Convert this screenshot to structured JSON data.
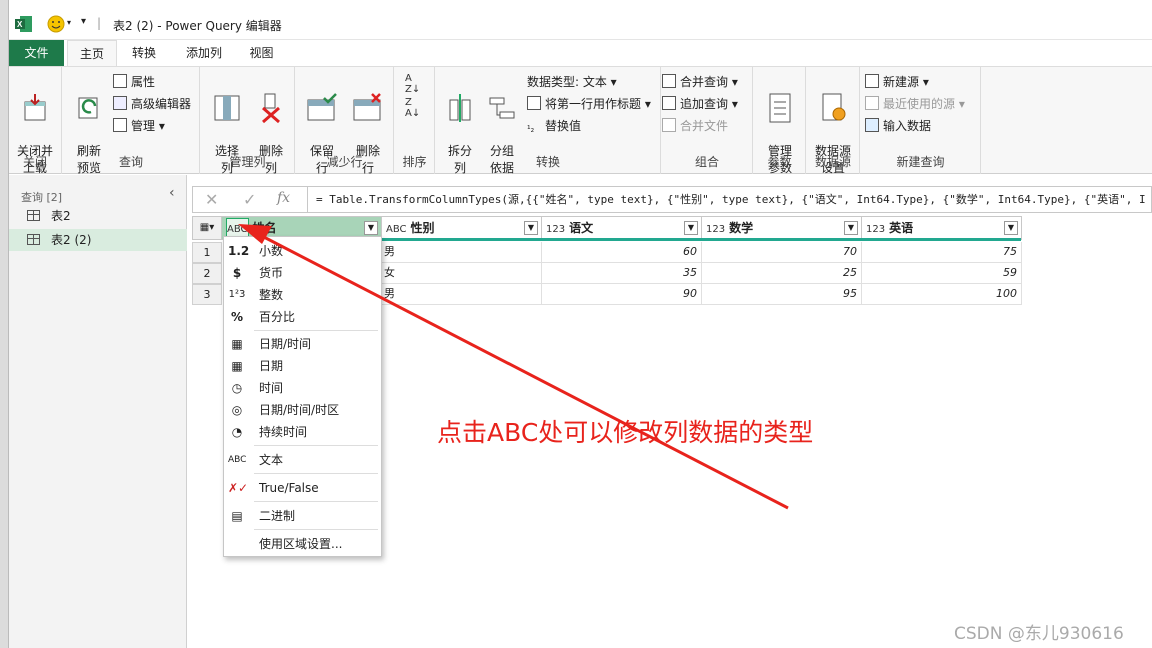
{
  "window": {
    "title": "表2 (2) - Power Query 编辑器"
  },
  "ribbon_tabs": [
    "文件",
    "主页",
    "转换",
    "添加列",
    "视图"
  ],
  "groups": {
    "close": {
      "label": "关闭",
      "btn": "关闭并\n上载"
    },
    "query": {
      "label": "查询",
      "refresh": "刷新\n预览",
      "props": "属性",
      "adv": "高级编辑器",
      "manage": "管理"
    },
    "cols": {
      "label": "管理列",
      "choose": "选择\n列",
      "remove": "删除\n列"
    },
    "rows": {
      "label": "减少行",
      "keep": "保留\n行",
      "remove": "删除\n行"
    },
    "sort": {
      "label": "排序"
    },
    "transform": {
      "label": "转换",
      "split": "拆分\n列",
      "group": "分组\n依据",
      "dtype": "数据类型: 文本",
      "firstrow": "将第一行用作标题",
      "replace": "替换值"
    },
    "combine": {
      "label": "组合",
      "merge": "合并查询",
      "append": "追加查询",
      "files": "合并文件"
    },
    "params": {
      "label": "参数",
      "manage": "管理\n参数"
    },
    "ds": {
      "label": "数据源",
      "settings": "数据源\n设置"
    },
    "newq": {
      "label": "新建查询",
      "new": "新建源",
      "recent": "最近使用的源",
      "enter": "输入数据"
    }
  },
  "sidebar": {
    "header": "查询 [2]",
    "items": [
      "表2",
      "表2 (2)"
    ]
  },
  "formula": "= Table.TransformColumnTypes(源,{{\"姓名\", type text}, {\"性别\", type text}, {\"语文\", Int64.Type}, {\"数学\", Int64.Type}, {\"英语\", I",
  "table": {
    "columns": [
      {
        "type": "ABC",
        "name": "姓名"
      },
      {
        "type": "ABC",
        "name": "性别"
      },
      {
        "type": "123",
        "name": "语文"
      },
      {
        "type": "123",
        "name": "数学"
      },
      {
        "type": "123",
        "name": "英语"
      }
    ],
    "rows": [
      {
        "n": "1",
        "sex": "男",
        "yw": "60",
        "sx": "70",
        "yy": "75"
      },
      {
        "n": "2",
        "sex": "女",
        "yw": "35",
        "sx": "25",
        "yy": "59"
      },
      {
        "n": "3",
        "sex": "男",
        "yw": "90",
        "sx": "95",
        "yy": "100"
      }
    ]
  },
  "type_menu": [
    {
      "icon": "1.2",
      "label": "小数"
    },
    {
      "icon": "$",
      "label": "货币"
    },
    {
      "icon": "123",
      "label": "整数"
    },
    {
      "icon": "%",
      "label": "百分比"
    },
    {
      "icon": "datetime",
      "label": "日期/时间"
    },
    {
      "icon": "date",
      "label": "日期"
    },
    {
      "icon": "time",
      "label": "时间"
    },
    {
      "icon": "tz",
      "label": "日期/时间/时区"
    },
    {
      "icon": "duration",
      "label": "持续时间"
    },
    {
      "icon": "ABC",
      "label": "文本"
    },
    {
      "icon": "bool",
      "label": "True/False"
    },
    {
      "icon": "binary",
      "label": "二进制"
    },
    {
      "icon": "",
      "label": "使用区域设置..."
    }
  ],
  "annotation": "点击ABC处可以修改列数据的类型",
  "watermark": "CSDN @东儿930616",
  "colors": {
    "accent": "#217346",
    "tab_active": "#1e7a4a",
    "annot": "#e8231c",
    "header_active": "#a8d4b8"
  }
}
